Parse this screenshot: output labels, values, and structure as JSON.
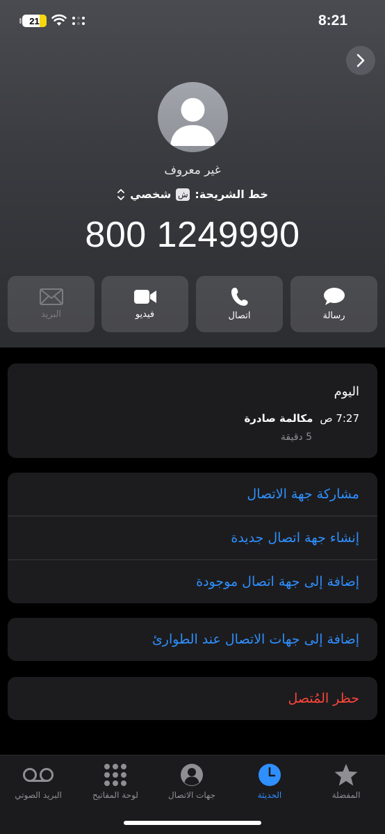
{
  "status_bar": {
    "time": "8:21",
    "battery_level": "21",
    "battery_color": "#f5d60f"
  },
  "header": {
    "next_icon": "chevron-right-icon",
    "caller_name": "غير معروف",
    "sim_label": "خط الشريحة:",
    "sim_badge": "ش",
    "sim_name": "شخصي",
    "phone_number": "800 1249990"
  },
  "actions": [
    {
      "label": "رسالة",
      "icon": "message-bubble-icon",
      "enabled": true
    },
    {
      "label": "اتصال",
      "icon": "phone-icon",
      "enabled": true
    },
    {
      "label": "فيديو",
      "icon": "video-camera-icon",
      "enabled": true
    },
    {
      "label": "البريد",
      "icon": "mail-icon",
      "enabled": false
    }
  ],
  "recent": {
    "day": "اليوم",
    "time": "7:27 ص",
    "kind": "مكالمة صادرة",
    "duration": "5 دقيقة"
  },
  "contact_options": [
    "مشاركة جهة الاتصال",
    "إنشاء جهة اتصال جديدة",
    "إضافة إلى جهة اتصال موجودة"
  ],
  "emergency_option": "إضافة إلى جهات الاتصال عند الطوارئ",
  "block_option": "حظر المُتصل",
  "colors": {
    "accent": "#2f8fff",
    "destructive": "#ff453a"
  },
  "tabs": [
    {
      "label": "المفضلة",
      "icon": "star-icon",
      "active": false
    },
    {
      "label": "الحديثة",
      "icon": "clock-icon",
      "active": true
    },
    {
      "label": "جهات الاتصال",
      "icon": "person-circle-icon",
      "active": false
    },
    {
      "label": "لوحة المفاتيح",
      "icon": "keypad-icon",
      "active": false
    },
    {
      "label": "البريد الصوتي",
      "icon": "voicemail-icon",
      "active": false
    }
  ]
}
